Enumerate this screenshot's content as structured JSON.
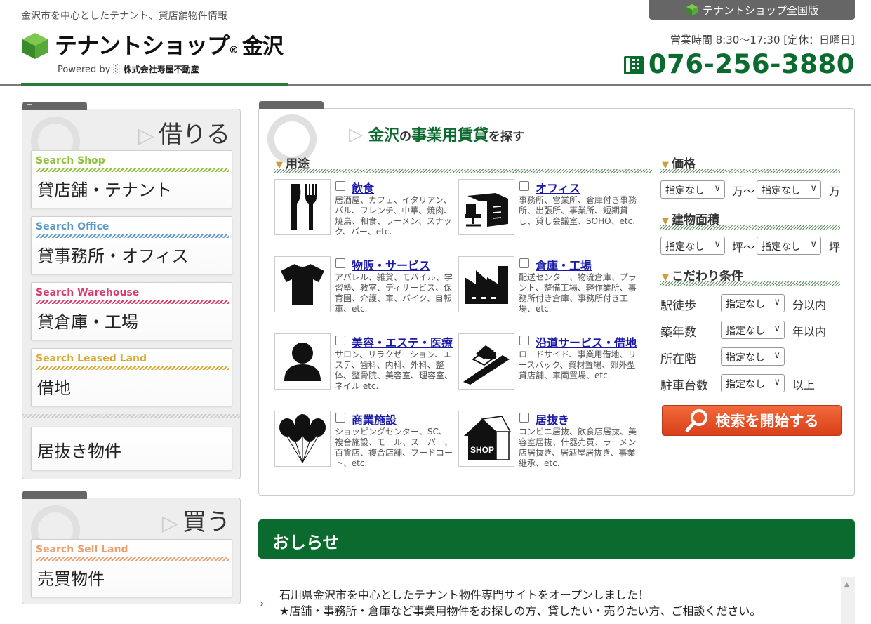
{
  "header": {
    "tagline": "金沢市を中心としたテナント、貸店舗物件情報",
    "logo_text": "テナントショップ",
    "logo_reg": "®",
    "logo_city": "金沢",
    "powered_by": "Powered by",
    "company": "株式会社寿屋不動産",
    "national_button": "テナントショップ全国版",
    "hours": "営業時間 8:30〜17:30 [定休：日曜日]",
    "phone": "076-256-3880",
    "colors": {
      "brand_green": "#0b6b2e"
    }
  },
  "rent": {
    "heading": "借りる",
    "cards": [
      {
        "en": "Search Shop",
        "jp": "貸店舗・テナント",
        "color": "#8fc03a"
      },
      {
        "en": "Search Office",
        "jp": "貸事務所・オフィス",
        "color": "#5a9ac8"
      },
      {
        "en": "Search Warehouse",
        "jp": "貸倉庫・工場",
        "color": "#d83a6a"
      },
      {
        "en": "Search Leased Land",
        "jp": "借地",
        "color": "#d8a830"
      }
    ],
    "inuki": "居抜き物件"
  },
  "buy": {
    "heading": "買う",
    "cards": [
      {
        "en": "Search Sell Land",
        "jp": "売買物件",
        "color": "#e8a070"
      }
    ]
  },
  "search": {
    "title_city": "金沢",
    "title_no": "の",
    "title_main": "事業用賃貸",
    "title_end": "を探す",
    "usage_heading": "用途",
    "categories": [
      {
        "title": "飲食",
        "desc": "居酒屋、カフェ、イタリアン、バル、フレンチ、中華、焼肉、焼鳥、和食、ラーメン、スナック、バー、etc.",
        "icon": "fork-knife-icon"
      },
      {
        "title": "オフィス",
        "desc": "事務所、営業所、倉庫付き事務所、出張所、事業所、短期貸し、貸し会議室、SOHO、etc.",
        "icon": "office-desk-icon"
      },
      {
        "title": "物販・サービス",
        "desc": "アパレル、雑貨、モバイル、学習塾、教室、ディサービス、保育園、介護、車、バイク、自転車、etc.",
        "icon": "tshirt-icon"
      },
      {
        "title": "倉庫・工場",
        "desc": "配送センター、物流倉庫、プラント、整備工場、軽作業所、事務所付き倉庫、事務所付き工場、etc.",
        "icon": "factory-icon"
      },
      {
        "title": "美容・エステ・医療",
        "desc": "サロン、リラクゼーション、エステ、歯科、内科、外科、整体、整骨院、美容室、理容室、ネイル etc.",
        "icon": "person-icon"
      },
      {
        "title": "沿道サービス・借地",
        "desc": "ロードサイド、事業用借地、リースバック、資材置場、郊外型貸店舗、車両置場、etc.",
        "icon": "roadside-icon"
      },
      {
        "title": "商業施設",
        "desc": "ショッピングセンター、SC、複合施設、モール、スーパー、百貨店、複合店舗、フードコート、etc.",
        "icon": "balloons-icon"
      },
      {
        "title": "居抜き",
        "desc": "コンビニ居抜、飲食店居抜、美容室居抜、什器売買、ラーメン店居抜き、居酒屋居抜き、事業継承、etc.",
        "icon": "shop-house-icon"
      }
    ],
    "price_heading": "価格",
    "area_heading": "建物面積",
    "cond_heading": "こだわり条件",
    "select_default": "指定なし",
    "unit_man_tilde": "万〜",
    "unit_man": "万",
    "unit_tsubo_tilde": "坪〜",
    "unit_tsubo": "坪",
    "conditions": [
      {
        "label": "駅徒歩",
        "unit": "分以内"
      },
      {
        "label": "築年数",
        "unit": "年以内"
      },
      {
        "label": "所在階",
        "unit": ""
      },
      {
        "label": "駐車台数",
        "unit": "以上"
      }
    ],
    "search_button": "検索を開始する"
  },
  "news": {
    "heading": "おしらせ",
    "line1": "石川県金沢市を中心としたテナント物件専門サイトをオープンしました！",
    "line2": "★店舗・事務所・倉庫など事業用物件をお探しの方、貸したい・売りたい方、ご相談ください。"
  }
}
